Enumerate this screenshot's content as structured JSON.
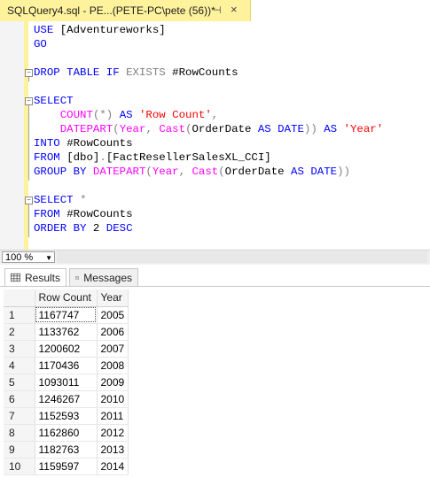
{
  "tab": {
    "title": "SQLQuery4.sql - PE...(PETE-PC\\pete (56))*",
    "pin": "⊣",
    "close": "×"
  },
  "editor": {
    "lines": [
      {
        "parts": [
          {
            "t": "USE ",
            "c": "kw"
          },
          {
            "t": "[Adventureworks]",
            "c": ""
          }
        ]
      },
      {
        "parts": [
          {
            "t": "GO",
            "c": "kw"
          }
        ]
      },
      {
        "parts": []
      },
      {
        "fold": true,
        "parts": [
          {
            "t": "DROP TABLE IF ",
            "c": "kw"
          },
          {
            "t": "EXISTS",
            "c": "gr"
          },
          {
            "t": " #RowCounts",
            "c": ""
          }
        ]
      },
      {
        "parts": []
      },
      {
        "fold": true,
        "parts": [
          {
            "t": "SELECT",
            "c": "kw"
          }
        ]
      },
      {
        "parts": [
          {
            "t": "    ",
            "c": ""
          },
          {
            "t": "COUNT",
            "c": "fn"
          },
          {
            "t": "(*) ",
            "c": "gr"
          },
          {
            "t": "AS ",
            "c": "kw"
          },
          {
            "t": "'Row Count'",
            "c": "str"
          },
          {
            "t": ",",
            "c": "gr"
          }
        ]
      },
      {
        "parts": [
          {
            "t": "    ",
            "c": ""
          },
          {
            "t": "DATEPART",
            "c": "fn"
          },
          {
            "t": "(",
            "c": "gr"
          },
          {
            "t": "Year",
            "c": "fn"
          },
          {
            "t": ", ",
            "c": "gr"
          },
          {
            "t": "Cast",
            "c": "fn"
          },
          {
            "t": "(",
            "c": "gr"
          },
          {
            "t": "OrderDate ",
            "c": ""
          },
          {
            "t": "AS DATE",
            "c": "kw"
          },
          {
            "t": ")) ",
            "c": "gr"
          },
          {
            "t": "AS ",
            "c": "kw"
          },
          {
            "t": "'Year'",
            "c": "str"
          }
        ]
      },
      {
        "parts": [
          {
            "t": "INTO ",
            "c": "kw"
          },
          {
            "t": "#RowCounts",
            "c": ""
          }
        ]
      },
      {
        "parts": [
          {
            "t": "FROM ",
            "c": "kw"
          },
          {
            "t": "[dbo]",
            "c": ""
          },
          {
            "t": ".",
            "c": "gr"
          },
          {
            "t": "[FactResellerSalesXL_CCI]",
            "c": ""
          }
        ]
      },
      {
        "parts": [
          {
            "t": "GROUP BY ",
            "c": "kw"
          },
          {
            "t": "DATEPART",
            "c": "fn"
          },
          {
            "t": "(",
            "c": "gr"
          },
          {
            "t": "Year",
            "c": "fn"
          },
          {
            "t": ", ",
            "c": "gr"
          },
          {
            "t": "Cast",
            "c": "fn"
          },
          {
            "t": "(",
            "c": "gr"
          },
          {
            "t": "OrderDate ",
            "c": ""
          },
          {
            "t": "AS DATE",
            "c": "kw"
          },
          {
            "t": "))",
            "c": "gr"
          }
        ]
      },
      {
        "parts": []
      },
      {
        "fold": true,
        "parts": [
          {
            "t": "SELECT ",
            "c": "kw"
          },
          {
            "t": "*",
            "c": "gr"
          }
        ]
      },
      {
        "parts": [
          {
            "t": "FROM ",
            "c": "kw"
          },
          {
            "t": "#RowCounts",
            "c": ""
          }
        ]
      },
      {
        "parts": [
          {
            "t": "ORDER BY ",
            "c": "kw"
          },
          {
            "t": "2 ",
            "c": ""
          },
          {
            "t": "DESC",
            "c": "kw"
          }
        ]
      }
    ]
  },
  "zoom": {
    "value": "100 %",
    "arrow": "▼"
  },
  "results": {
    "tabs": [
      {
        "label": "Results"
      },
      {
        "label": "Messages"
      }
    ],
    "columns": [
      "Row Count",
      "Year"
    ],
    "rows": [
      [
        "1",
        "1167747",
        "2005"
      ],
      [
        "2",
        "1133762",
        "2006"
      ],
      [
        "3",
        "1200602",
        "2007"
      ],
      [
        "4",
        "1170436",
        "2008"
      ],
      [
        "5",
        "1093011",
        "2009"
      ],
      [
        "6",
        "1246267",
        "2010"
      ],
      [
        "7",
        "1152593",
        "2011"
      ],
      [
        "8",
        "1162860",
        "2012"
      ],
      [
        "9",
        "1182763",
        "2013"
      ],
      [
        "10",
        "1159597",
        "2014"
      ]
    ]
  }
}
